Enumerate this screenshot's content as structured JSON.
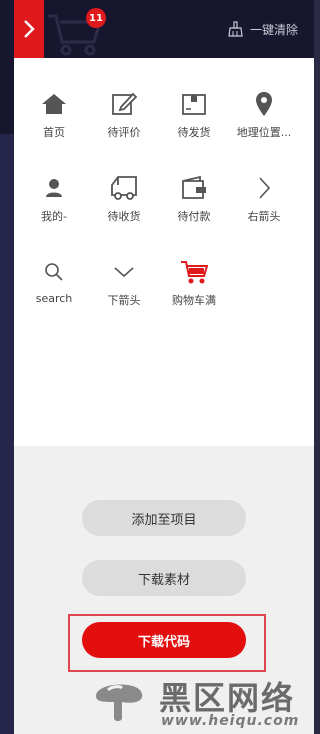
{
  "header": {
    "cart_badge_count": "11",
    "clear_all_label": "一键清除"
  },
  "grid": {
    "items": [
      {
        "label": "首页",
        "icon": "home-icon"
      },
      {
        "label": "待评价",
        "icon": "edit-icon"
      },
      {
        "label": "待发货",
        "icon": "box-icon"
      },
      {
        "label": "地理位置...",
        "icon": "location-pin-icon"
      },
      {
        "label": "我的-",
        "icon": "user-icon"
      },
      {
        "label": "待收货",
        "icon": "truck-icon"
      },
      {
        "label": "待付款",
        "icon": "wallet-icon"
      },
      {
        "label": "右箭头",
        "icon": "chevron-right-icon"
      },
      {
        "label": "search",
        "icon": "search-icon"
      },
      {
        "label": "下箭头",
        "icon": "chevron-down-icon"
      },
      {
        "label": "购物车满",
        "icon": "cart-full-icon"
      }
    ]
  },
  "actions": {
    "add_to_project_label": "添加至项目",
    "download_assets_label": "下载素材",
    "download_code_label": "下载代码"
  },
  "watermark": {
    "name": "黑区网络",
    "url": "www.heiqu.com"
  },
  "colors": {
    "accent_red": "#e30e0e",
    "header_bg": "#16162e"
  }
}
